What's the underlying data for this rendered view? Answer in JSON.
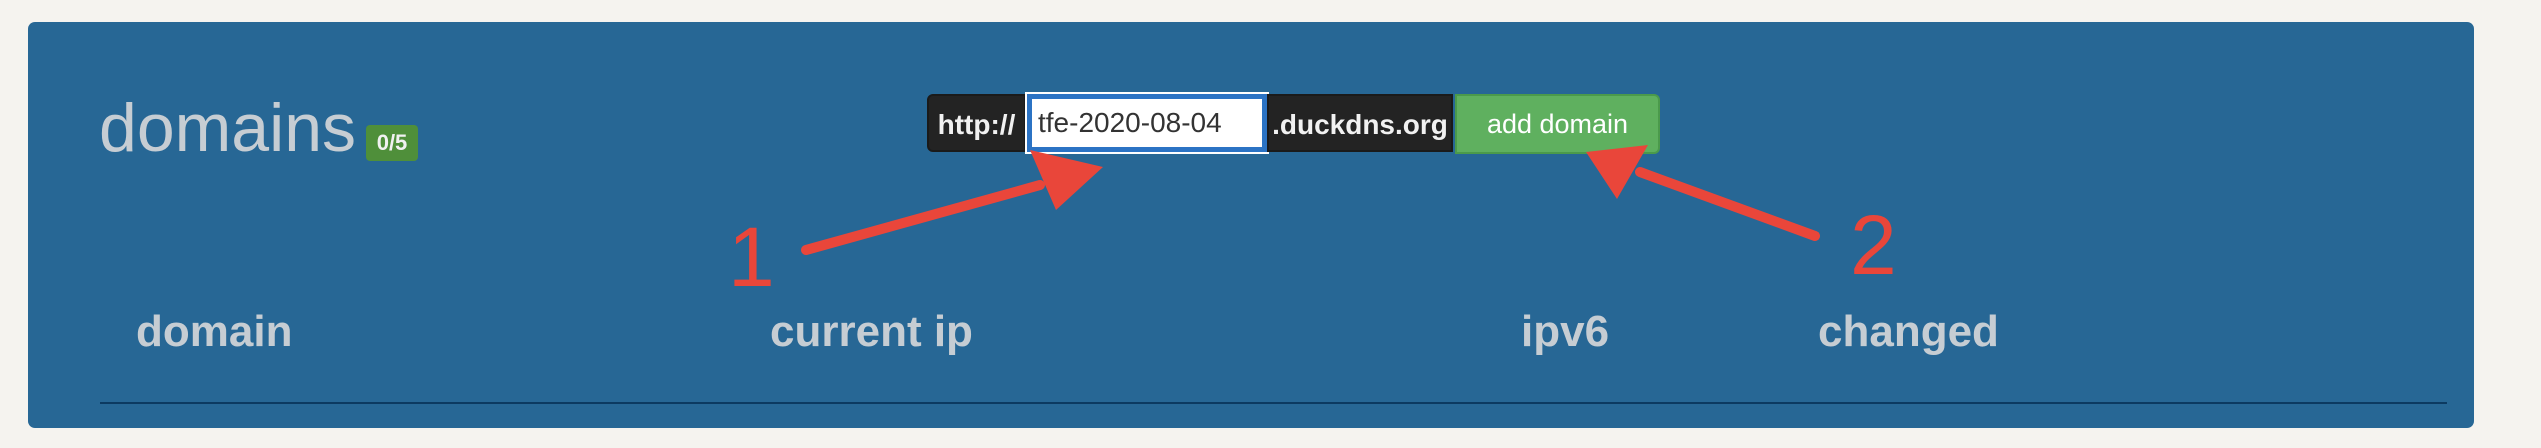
{
  "header": {
    "title": "domains",
    "badge": "0/5"
  },
  "add_form": {
    "prefix": "http://",
    "input_value": "tfe-2020-08-04",
    "suffix": ".duckdns.org",
    "button_label": "add domain"
  },
  "annotations": {
    "label_1": "1",
    "label_2": "2",
    "color": "#e9463a"
  },
  "table": {
    "columns": [
      "domain",
      "current ip",
      "ipv6",
      "changed"
    ]
  },
  "colors": {
    "panel": "#276795",
    "button": "#5fb05f",
    "input_focus": "#2b73c4"
  }
}
